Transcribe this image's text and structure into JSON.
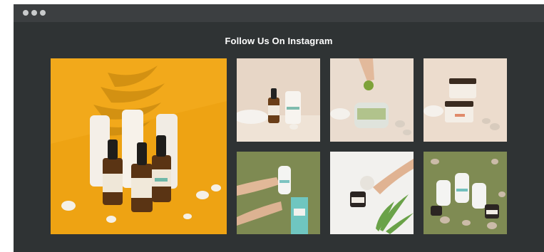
{
  "window": {
    "title_dots": [
      "close",
      "minimize",
      "maximize"
    ]
  },
  "section": {
    "heading": "Follow Us On Instagram"
  },
  "colors": {
    "frame_bg": "#2f3334",
    "titlebar_bg": "#3c3f41",
    "heading_text": "#ffffff",
    "featured_bg": "#f2a91b",
    "beige_bg": "#e9dccf",
    "olive_bg": "#7e8a52",
    "white_bg": "#f2f1ee"
  },
  "gallery": {
    "featured": {
      "icon": "instagram-post-image",
      "scene": "dropper bottles and boxes on orange"
    },
    "posts": [
      {
        "icon": "instagram-post-image",
        "scene": "serum bottle and box on beige"
      },
      {
        "icon": "instagram-post-image",
        "scene": "hand holding gummy over jar"
      },
      {
        "icon": "instagram-post-image",
        "scene": "stacked jars on beige"
      },
      {
        "icon": "instagram-post-image",
        "scene": "hands applying cream on olive"
      },
      {
        "icon": "instagram-post-image",
        "scene": "hand holding jar with palm leaf"
      },
      {
        "icon": "instagram-post-image",
        "scene": "product lineup on olive"
      }
    ]
  }
}
